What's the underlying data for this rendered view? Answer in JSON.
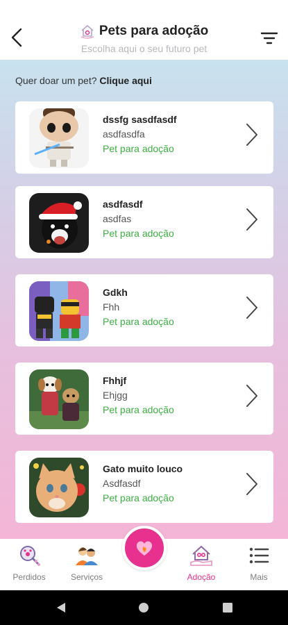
{
  "header": {
    "title": "Pets para adoção",
    "subtitle": "Escolha aqui o seu futuro pet"
  },
  "donate": {
    "question": "Quer doar um pet?",
    "link": "Clique aqui"
  },
  "pets": [
    {
      "name": "dssfg sasdfasdf",
      "desc": "asdfasdfa",
      "status": "Pet para adoção",
      "image": "funko-figure"
    },
    {
      "name": "asdfasdf",
      "desc": "asdfas",
      "status": "Pet para adoção",
      "image": "dog-santa-hat"
    },
    {
      "name": "Gdkh",
      "desc": "Fhh",
      "status": "Pet para adoção",
      "image": "lego-figures"
    },
    {
      "name": "Fhhjf",
      "desc": "Ehjgg",
      "status": "Pet para adoção",
      "image": "two-puppies"
    },
    {
      "name": "Gato muito louco",
      "desc": "Asdfasdf",
      "status": "Pet para adoção",
      "image": "kitten-christmas"
    }
  ],
  "nav": {
    "lost": "Perdidos",
    "services": "Serviços",
    "adoption": "Adoção",
    "more": "Mais"
  },
  "colors": {
    "accent": "#e8308e",
    "status_green": "#3cb043"
  }
}
